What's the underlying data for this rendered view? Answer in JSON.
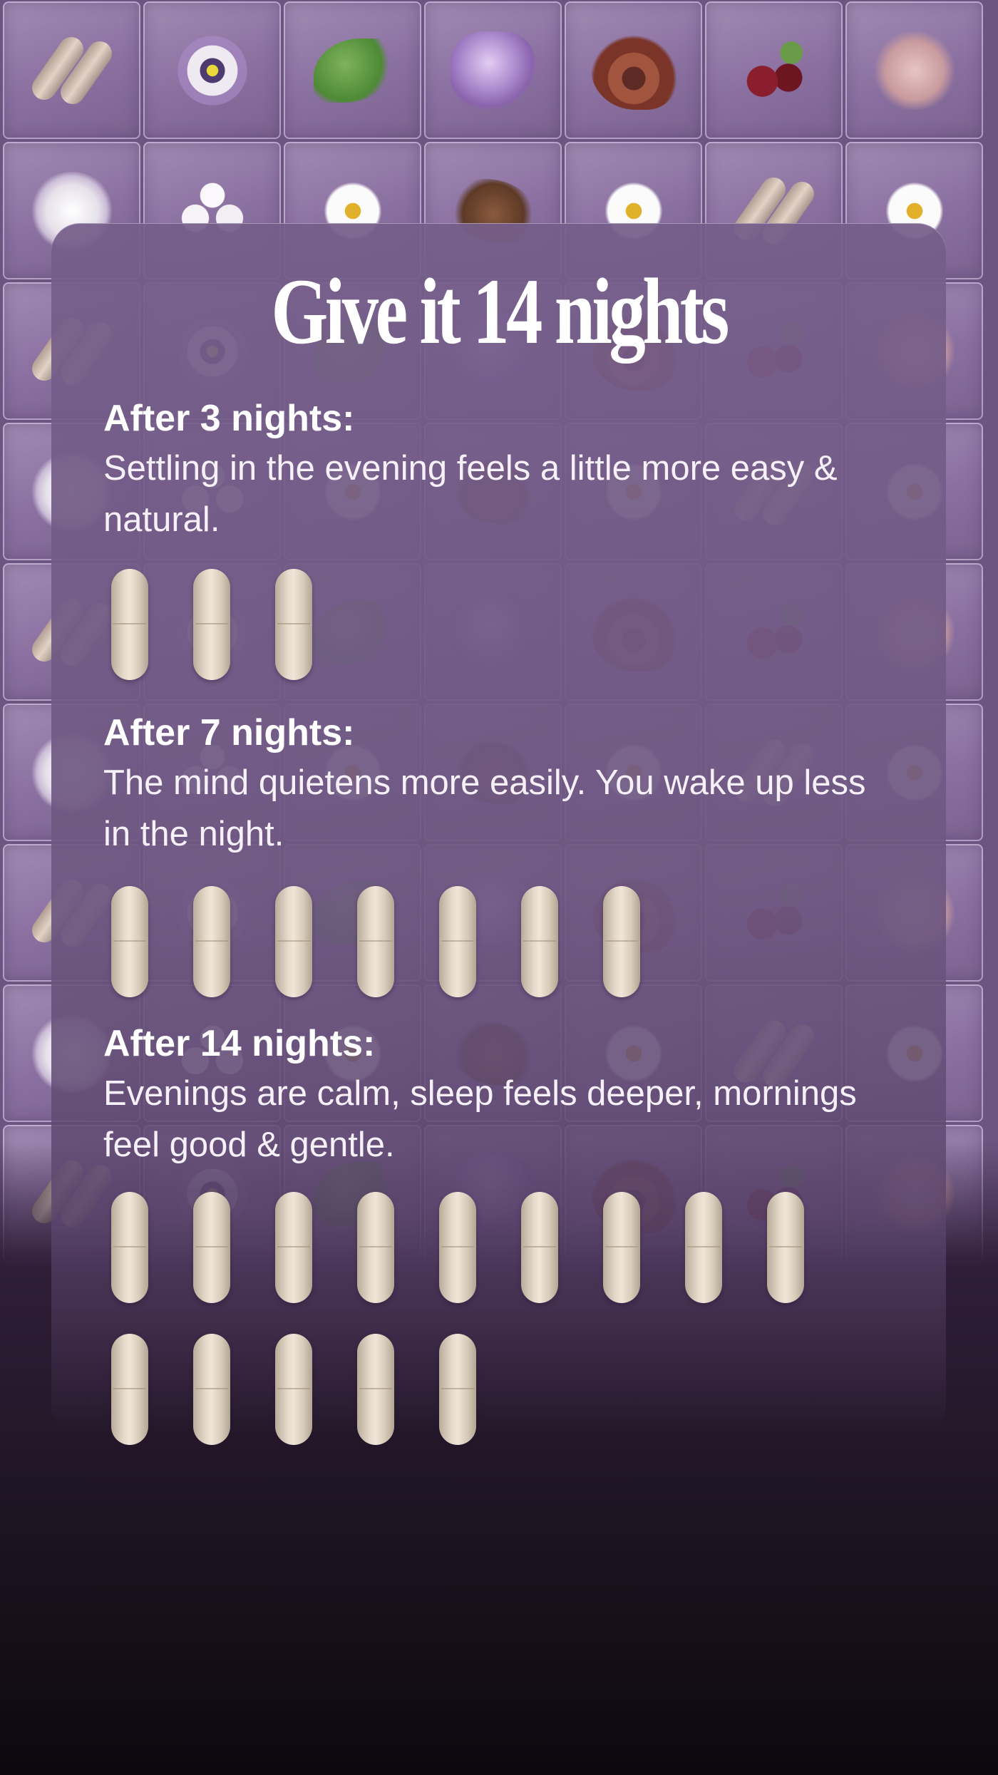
{
  "headline": "Give it 14 nights",
  "milestones": [
    {
      "title": "After 3 nights:",
      "description": "Settling in the evening feels a little more easy & natural.",
      "capsules": 3
    },
    {
      "title": "After 7 nights:",
      "description": "The mind quietens more easily. You wake up less in the night.",
      "capsules": 7
    },
    {
      "title": "After 14 nights:",
      "description": "Evenings are calm, sleep feels deeper, mornings feel good & gentle.",
      "capsules": 14
    }
  ],
  "background_tiles": [
    "capsules-icon",
    "passionflower-icon",
    "lemon-balm-leaf-icon",
    "amethyst-crystal-icon",
    "reishi-mushroom-icon",
    "cherry-icon",
    "rose-icon",
    "sugar-crystals-icon",
    "pills-icon",
    "chamomile-icon",
    "valerian-root-icon",
    "chamomile-icon",
    "capsules-icon",
    "chamomile-icon"
  ],
  "colors": {
    "card": "#76608a",
    "text": "#ffffff",
    "capsule": "#e6dccd",
    "background_dark": "#0c080e"
  }
}
